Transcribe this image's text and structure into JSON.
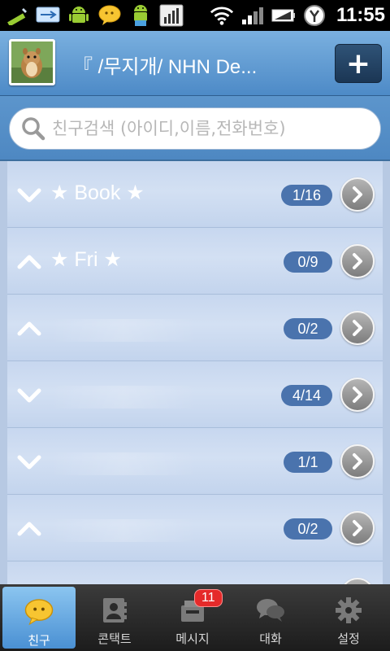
{
  "status_bar": {
    "time": "11:55",
    "icons": [
      "pencil-icon",
      "usb-icon",
      "android-icon",
      "chat-bubble-icon",
      "android-debug-icon",
      "signal-bars-app-icon",
      "wifi-icon",
      "cell-signal-icon",
      "battery-icon",
      "y-app-icon"
    ]
  },
  "header": {
    "title": "『 /무지개/ NHN De...",
    "add_label": "+"
  },
  "search": {
    "placeholder": "친구검색 (아이디,이름,전화번호)",
    "value": ""
  },
  "groups": [
    {
      "name": "★ Book ★",
      "count": "1/16",
      "expanded": false
    },
    {
      "name": "★ Fri ★",
      "count": "0/9",
      "expanded": true
    },
    {
      "name": "",
      "count": "0/2",
      "expanded": true
    },
    {
      "name": "",
      "count": "4/14",
      "expanded": false
    },
    {
      "name": "",
      "count": "1/1",
      "expanded": false
    },
    {
      "name": "",
      "count": "0/2",
      "expanded": true
    },
    {
      "name": "",
      "count": "",
      "expanded": false
    }
  ],
  "tabs": [
    {
      "label": "친구",
      "icon": "friends-bubble-icon",
      "active": true
    },
    {
      "label": "콘택트",
      "icon": "contact-card-icon",
      "active": false
    },
    {
      "label": "메시지",
      "icon": "message-inbox-icon",
      "active": false,
      "badge": "11"
    },
    {
      "label": "대화",
      "icon": "chat-icon",
      "active": false
    },
    {
      "label": "설정",
      "icon": "gear-icon",
      "active": false
    }
  ],
  "colors": {
    "header": "#5b97d0",
    "count_badge": "#4a73ad",
    "active_tab": "#6aaee6",
    "message_badge": "#e52a2a"
  }
}
